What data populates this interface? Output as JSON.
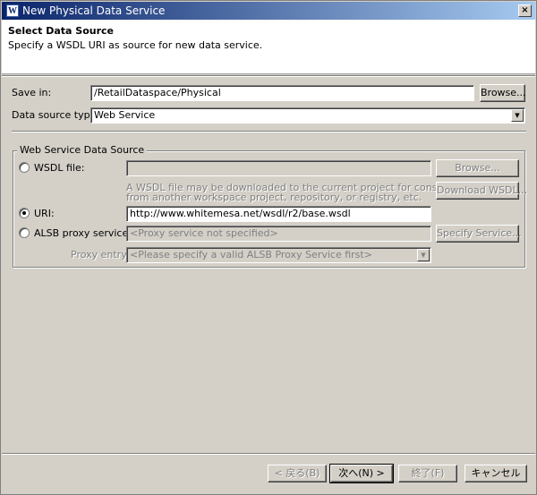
{
  "window": {
    "title": "New Physical Data Service",
    "close_glyph": "×",
    "icon": "weblogic-app-icon"
  },
  "banner": {
    "heading": "Select Data Source",
    "description": "Specify a WSDL URI as source for new data service."
  },
  "form": {
    "save_in": {
      "label": "Save in:",
      "value": "/RetailDataspace/Physical",
      "button": "Browse..."
    },
    "data_source_type": {
      "label": "Data source type:",
      "value": "Web Service"
    }
  },
  "group": {
    "title": "Web Service Data Source",
    "wsdl_file": {
      "label": "WSDL file:",
      "value": "",
      "selected": false,
      "browse_button": "Browse...",
      "help": "A WSDL file may be downloaded to the current project for consumption from another workspace project, repository, or registry, etc.",
      "help_line1": "A WSDL file may be downloaded to the current project for consumption",
      "help_line2": "from another workspace project, repository, or registry, etc.",
      "download_button": "Download WSDL..."
    },
    "uri": {
      "label": "URI:",
      "value": "http://www.whitemesa.net/wsdl/r2/base.wsdl",
      "selected": true
    },
    "alsb": {
      "label": "ALSB proxy service:",
      "placeholder": "<Proxy service not specified>",
      "selected": false,
      "specify_button": "Specify Service..."
    },
    "proxy_entry": {
      "label": "Proxy entry:",
      "placeholder": "<Please specify a valid ALSB Proxy Service first>"
    }
  },
  "footer": {
    "back": "< 戻る(B)",
    "next": "次へ(N) >",
    "finish": "終了(F)",
    "cancel": "キャンセル"
  }
}
